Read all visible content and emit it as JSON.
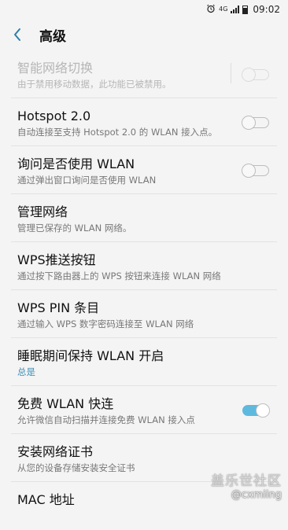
{
  "status_bar": {
    "time": "09:02",
    "network": "4G",
    "icons": [
      "alarm-icon",
      "signal-icon",
      "battery-icon"
    ]
  },
  "header": {
    "title": "高级",
    "back_icon": "chevron-left-icon"
  },
  "settings": [
    {
      "title": "智能网络切换",
      "subtitle": "由于禁用移动数据，此功能已被禁用。",
      "toggle": "off",
      "disabled": true
    },
    {
      "title": "Hotspot 2.0",
      "subtitle": "自动连接至支持 Hotspot 2.0 的 WLAN 接入点。",
      "toggle": "off"
    },
    {
      "title": "询问是否使用 WLAN",
      "subtitle": "通过弹出窗口询问是否使用 WLAN",
      "toggle": "off"
    },
    {
      "title": "管理网络",
      "subtitle": "管理已保存的 WLAN 网络。"
    },
    {
      "title": "WPS推送按钮",
      "subtitle": "通过按下路由器上的 WPS 按钮来连接 WLAN 网络"
    },
    {
      "title": "WPS PIN 条目",
      "subtitle": "通过输入 WPS 数字密码连接至 WLAN 网络"
    },
    {
      "title": "睡眠期间保持 WLAN 开启",
      "subtitle": "总是"
    },
    {
      "title": "免费 WLAN 快连",
      "subtitle": "允许微信自动扫描并连接免费 WLAN 接入点",
      "toggle": "on"
    },
    {
      "title": "安装网络证书",
      "subtitle": "从您的设备存储安装安全证书"
    },
    {
      "title": "MAC 地址"
    }
  ],
  "watermark": {
    "site": "盖乐世社区",
    "user": "@cxmiing"
  },
  "colors": {
    "accent": "#5eb9de",
    "link": "#3a8fb7",
    "background": "#f4f4f4"
  }
}
